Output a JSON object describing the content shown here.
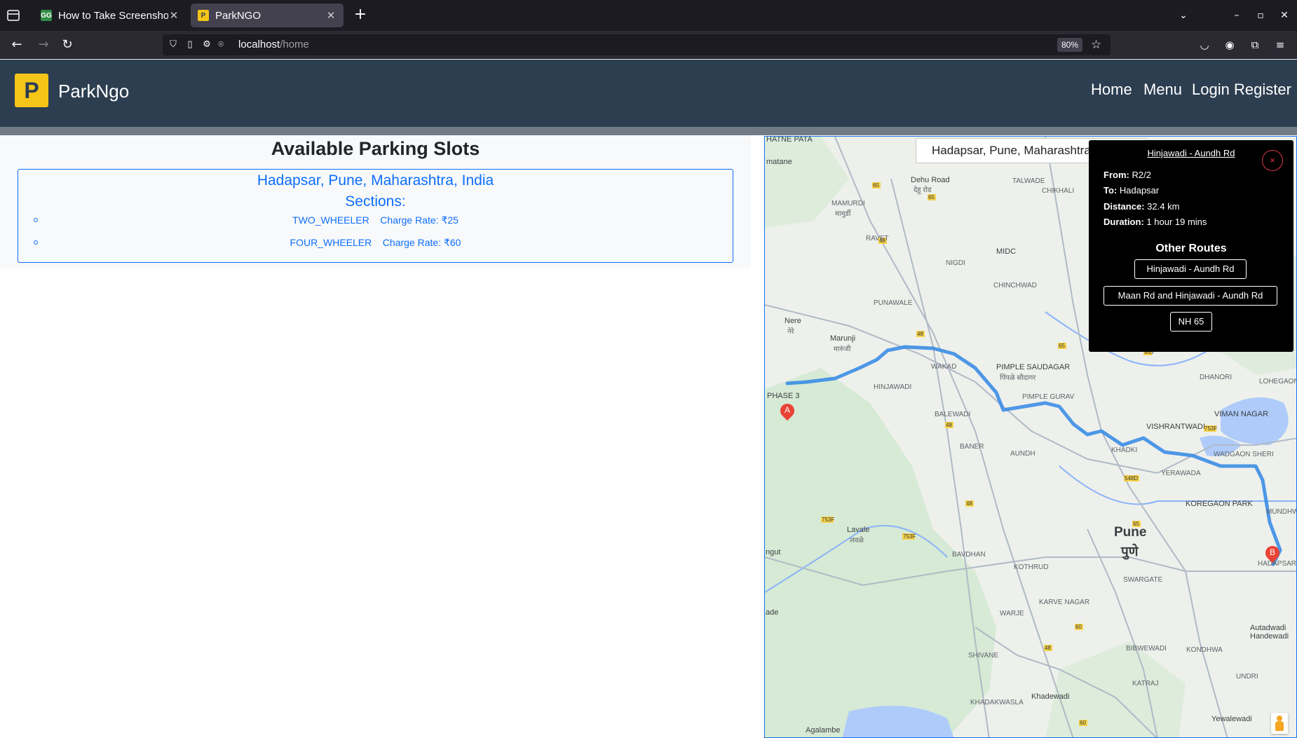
{
  "browser": {
    "tabs": [
      {
        "title": "How to Take Screenshot",
        "favicon": "GG",
        "active": false
      },
      {
        "title": "ParkNGO",
        "favicon": "P",
        "active": true
      }
    ],
    "url_host": "localhost",
    "url_path": "/home",
    "zoom": "80%"
  },
  "site": {
    "logo_letter": "P",
    "brand": "ParkNgo",
    "nav": [
      "Home",
      "Menu",
      "Login",
      "Register"
    ]
  },
  "parking": {
    "title": "Available Parking Slots",
    "location": "Hadapsar, Pune, Maharashtra, India",
    "sections_label": "Sections:",
    "sections": [
      {
        "type": "TWO_WHEELER",
        "rate_label": "Charge Rate: ₹25"
      },
      {
        "type": "FOUR_WHEELER",
        "rate_label": "Charge Rate: ₹60"
      }
    ]
  },
  "map": {
    "search_value": "Hadapsar, Pune, Maharashtra, India",
    "markers": [
      "A",
      "B"
    ],
    "labels": {
      "dehu_road": "Dehu Road",
      "dehu_road_mr": "देहू रोड",
      "mamurdi": "MAMURDI",
      "mamurdi_mr": "मामुर्डी",
      "talwade": "TALWADE",
      "chikhali": "CHIKHALI",
      "ravet": "RAVET",
      "midc": "MIDC",
      "nigdi": "NIGDI",
      "chinchwad": "CHINCHWAD",
      "punawale": "PUNAWALE",
      "nere": "Nere",
      "nere_mr": "नेरे",
      "marunji": "Marunji",
      "marunji_mr": "मारुंजी",
      "wakad": "WAKAD",
      "pimple_saudagar": "PIMPLE SAUDAGAR",
      "pimple_saudagar_mr": "पिंपळे सौदागर",
      "phase3": "PHASE 3",
      "hinjawadi": "HINJAWADI",
      "balewadi": "BALEWADI",
      "pimple_gurav": "PIMPLE GURAV",
      "baner": "BANER",
      "aundh": "AUNDH",
      "khadki": "KHADKI",
      "vishrantwadi": "VISHRANTWADI",
      "viman_nagar": "VIMAN NAGAR",
      "dhanori": "DHANORI",
      "lohegaon": "LOHEGAON",
      "wadgaon_sheri": "WADGAON SHERI",
      "yerawada": "YERAWADA",
      "koregaon_park": "KOREGAON PARK",
      "mundhwa": "MUNDHWA",
      "pune": "Pune",
      "pune_mr": "पुणे",
      "swargate": "SWARGATE",
      "lavale": "Lavale",
      "lavale_mr": "लवळे",
      "bavdhan": "BAVDHAN",
      "kothrud": "KOTHRUD",
      "karve_nagar": "KARVE NAGAR",
      "warje": "WARJE",
      "hadapsar": "HADAPSAR",
      "autadwadi": "Autadwadi Handewadi",
      "bibwewadi": "BIBWEWADI",
      "kondhwa": "KONDHWA",
      "undri": "UNDRI",
      "katraj": "KATRAJ",
      "shivane": "SHIVANE",
      "khadakwasla": "KHADAKWASLA",
      "khadewadi": "Khadewadi",
      "yewalewadi": "Yewalewadi",
      "agalambe": "Agalambe",
      "matane": "matane",
      "ngut": "ngut",
      "ade": "ade",
      "hatne_pata": "HATNE PATA"
    }
  },
  "route": {
    "title": "Hinjawadi - Aundh Rd",
    "from_label": "From:",
    "from": "R2/2",
    "to_label": "To:",
    "to": "Hadapsar",
    "distance_label": "Distance:",
    "distance": "32.4 km",
    "duration_label": "Duration:",
    "duration": "1 hour 19 mins",
    "other_routes_title": "Other Routes",
    "other_routes": [
      "Hinjawadi - Aundh Rd",
      "Maan Rd and Hinjawadi - Aundh Rd",
      "NH 65"
    ],
    "close_label": "×"
  }
}
